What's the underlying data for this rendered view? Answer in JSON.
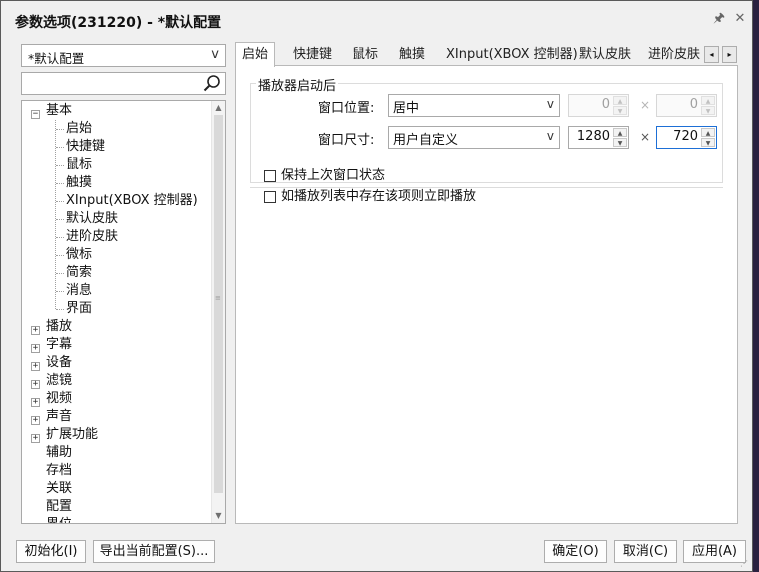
{
  "window": {
    "title": "参数选项(231220) - *默认配置",
    "pin_glyph": "🖈",
    "close_glyph": "✕"
  },
  "left": {
    "profile_select": {
      "value": "*默认配置",
      "arrow": "v"
    },
    "search": {
      "value": "",
      "placeholder": ""
    },
    "tree": {
      "expand_glyph": "⊟",
      "collapsed_glyph": "⊞",
      "root": "基本",
      "children": [
        "启始",
        "快捷键",
        "鼠标",
        "触摸",
        "XInput(XBOX 控制器)",
        "默认皮肤",
        "进阶皮肤",
        "微标",
        "简索",
        "消息",
        "界面"
      ],
      "groups": [
        "播放",
        "字幕",
        "设备",
        "滤镜",
        "视频",
        "声音",
        "扩展功能"
      ],
      "leaves": [
        "辅助",
        "存档",
        "关联",
        "配置",
        "界位"
      ]
    }
  },
  "tabs": {
    "items": [
      "启始",
      "快捷键",
      "鼠标",
      "触摸",
      "XInput(XBOX 控制器)",
      "默认皮肤",
      "进阶皮肤"
    ],
    "active": 0,
    "scroll_left": "◂",
    "scroll_right": "▸"
  },
  "startup": {
    "group_label": "播放器启动后",
    "position_label": "窗口位置:",
    "position_value": "居中",
    "position_x": "0",
    "position_y": "0",
    "size_label": "窗口尺寸:",
    "size_value": "用户自定义",
    "size_w": "1280",
    "size_h": "720",
    "times": "×",
    "dropdown_arrow": "v",
    "spin_up": "▲",
    "spin_down": "▼",
    "keep_state": {
      "label": "保持上次窗口状态",
      "checked": false
    },
    "play_if_in_list": {
      "label": "如播放列表中存在该项则立即播放",
      "checked": false
    }
  },
  "buttons": {
    "reset": "初始化(I)",
    "export": "导出当前配置(S)...",
    "ok": "确定(O)",
    "cancel": "取消(C)",
    "apply": "应用(A)"
  },
  "colors": {
    "window_bg": "#f0f0f0",
    "focus_border": "#1d6fd6"
  }
}
